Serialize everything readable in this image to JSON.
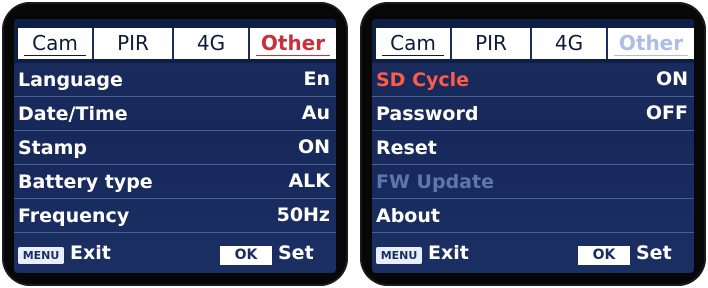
{
  "left_screen": {
    "tabs": [
      "Cam",
      "PIR",
      "4G",
      "Other"
    ],
    "active_tab": "Other",
    "rows": [
      {
        "label": "Language",
        "value": "En"
      },
      {
        "label": "Date/Time",
        "value": "Au"
      },
      {
        "label": "Stamp",
        "value": "ON"
      },
      {
        "label": "Battery type",
        "value": "ALK"
      },
      {
        "label": "Frequency",
        "value": "50Hz"
      }
    ],
    "footer": {
      "menu_key": "MENU",
      "exit": "Exit",
      "ok_key": "OK",
      "set": "Set"
    }
  },
  "right_screen": {
    "tabs": [
      "Cam",
      "PIR",
      "4G",
      "Other"
    ],
    "active_tab": "Other",
    "rows": [
      {
        "label": "SD Cycle",
        "value": "ON",
        "state": "selected"
      },
      {
        "label": "Password",
        "value": "OFF"
      },
      {
        "label": "Reset",
        "value": ""
      },
      {
        "label": "FW Update",
        "value": "",
        "state": "disabled"
      },
      {
        "label": "About",
        "value": ""
      }
    ],
    "footer": {
      "menu_key": "MENU",
      "exit": "Exit",
      "ok_key": "OK",
      "set": "Set"
    }
  },
  "colors": {
    "screen_bg": "#17285a",
    "active_tab_left": "#c8313c",
    "active_tab_right": "#aebde6",
    "selected_row": "#ff5b48",
    "disabled_row": "#5f76ab"
  }
}
